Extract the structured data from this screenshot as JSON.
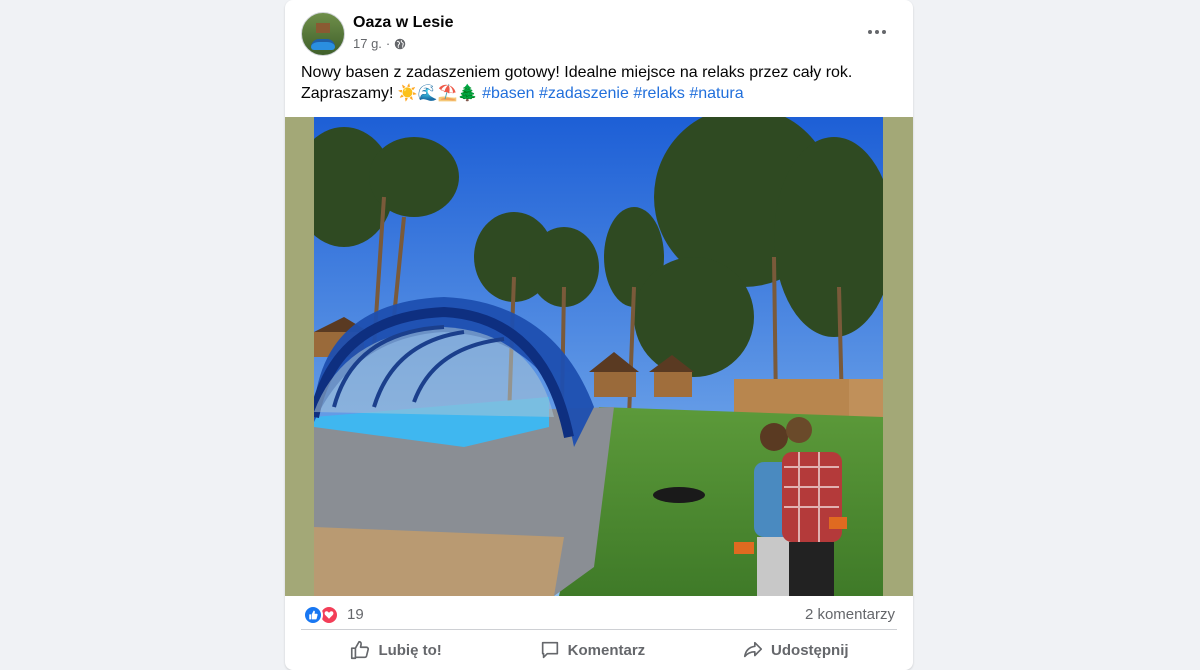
{
  "post": {
    "page_name": "Oaza w Lesie",
    "time_ago": "17 g.",
    "separator": "·",
    "audience_icon": "globe-icon",
    "more_icon": "more-horizontal-icon",
    "text_line1": "Nowy basen z zadaszeniem gotowy! Idealne miejsce na relaks przez cały rok.",
    "text_line2_start": "Zapraszamy! ",
    "emojis": "☀️🌊⛱️🌲",
    "hashtags": [
      "#basen",
      "#zadaszenie",
      "#relaks",
      "#natura"
    ],
    "image_description": "covered-pool-photo"
  },
  "reactions": {
    "icons": [
      "like-reaction-icon",
      "love-reaction-icon"
    ],
    "count": "19",
    "comments": "2 komentarzy"
  },
  "actions": {
    "like": "Lubię to!",
    "comment": "Komentarz",
    "share": "Udostępnij"
  },
  "colors": {
    "background": "#f0f2f5",
    "card": "#ffffff",
    "hashtag": "#216fdb",
    "secondary_text": "#65676b",
    "like_blue": "#1877f2",
    "love_red": "#f33e58",
    "photo_border": "#a3a877"
  }
}
